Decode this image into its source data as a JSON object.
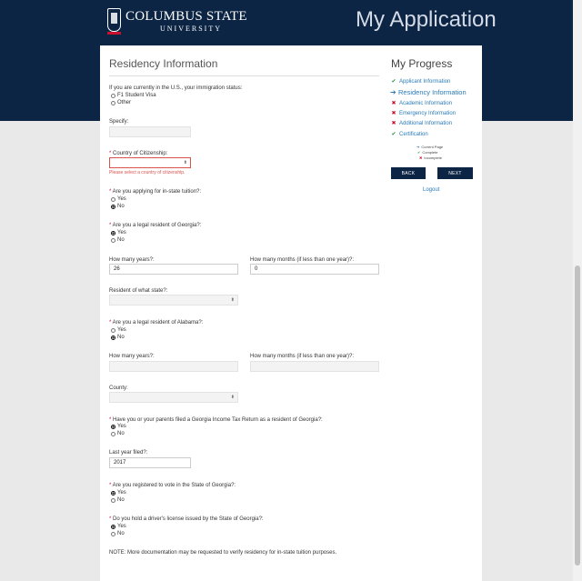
{
  "header": {
    "logo_line1": "COLUMBUS STATE",
    "logo_line2": "UNIVERSITY",
    "app_title": "My Application"
  },
  "colors": {
    "navy": "#0d2544",
    "required": "#c8102e",
    "link": "#2a7ab8",
    "complete": "#2e8b3e"
  },
  "form": {
    "section_title": "Residency Information",
    "immigration": {
      "label": "If you are currently in the U.S., your immigration status:",
      "options": [
        "F1 Student Visa",
        "Other"
      ]
    },
    "specify": {
      "label": "Specify:",
      "value": ""
    },
    "citizenship": {
      "label": "Country of Citizenship:",
      "value": "",
      "error": "Please select a country of citizenship."
    },
    "instate": {
      "label": "Are you applying for in-state tuition?:",
      "options": [
        "Yes",
        "No"
      ],
      "selected": "No"
    },
    "ga_resident": {
      "label": "Are you a legal resident of Georgia?:",
      "options": [
        "Yes",
        "No"
      ],
      "selected": "Yes"
    },
    "ga_years": {
      "label": "How many years?:",
      "value": "26"
    },
    "ga_months": {
      "label": "How many months (if less than one year)?:",
      "value": "0"
    },
    "resident_state": {
      "label": "Resident of what state?:",
      "value": ""
    },
    "al_resident": {
      "label": "Are you a legal resident of Alabama?:",
      "options": [
        "Yes",
        "No"
      ],
      "selected": "No"
    },
    "al_years": {
      "label": "How many years?:",
      "value": ""
    },
    "al_months": {
      "label": "How many months (if less than one year)?:",
      "value": ""
    },
    "county": {
      "label": "County:",
      "value": ""
    },
    "tax_return": {
      "label": "Have you or your parents filed a Georgia Income Tax Return as a resident of Georgia?:",
      "options": [
        "Yes",
        "No"
      ],
      "selected": "Yes"
    },
    "last_year": {
      "label": "Last year filed?:",
      "value": "2017"
    },
    "voter": {
      "label": "Are you registered to vote in the State of Georgia?:",
      "options": [
        "Yes",
        "No"
      ],
      "selected": "Yes"
    },
    "license": {
      "label": "Do you hold a driver's license issued by the State of Georgia?:",
      "options": [
        "Yes",
        "No"
      ],
      "selected": "Yes"
    },
    "note": "NOTE: More documentation may be requested to verify residency for in-state tuition purposes."
  },
  "progress": {
    "title": "My Progress",
    "items": [
      {
        "label": "Applicant Information",
        "status": "complete"
      },
      {
        "label": "Residency Information",
        "status": "current"
      },
      {
        "label": "Academic Information",
        "status": "incomplete"
      },
      {
        "label": "Emergency Information",
        "status": "incomplete"
      },
      {
        "label": "Additional Information",
        "status": "incomplete"
      },
      {
        "label": "Certification",
        "status": "complete"
      }
    ],
    "legend": [
      "Current Page",
      "Complete",
      "Incomplete"
    ],
    "back_label": "BACK",
    "next_label": "NEXT",
    "logout_label": "Logout"
  }
}
